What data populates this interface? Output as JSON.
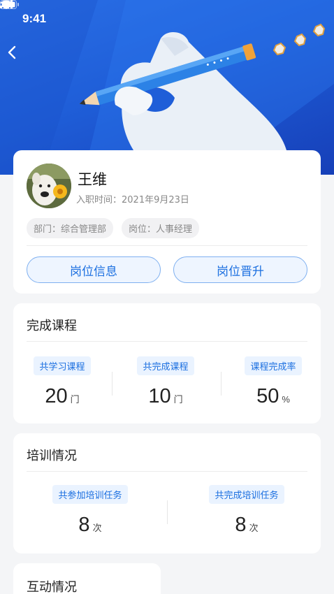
{
  "status_bar": {
    "time": "9:41"
  },
  "profile": {
    "name": "王维",
    "join_date": "入职时间：2021年9月23日",
    "department": "部门：综合管理部",
    "position": "岗位：人事经理",
    "btn_info": "岗位信息",
    "btn_promotion": "岗位晋升"
  },
  "courses": {
    "title": "完成课程",
    "stats": [
      {
        "label": "共学习课程",
        "value": "20",
        "unit": "门"
      },
      {
        "label": "共完成课程",
        "value": "10",
        "unit": "门"
      },
      {
        "label": "课程完成率",
        "value": "50",
        "unit": "%"
      }
    ]
  },
  "training": {
    "title": "培训情况",
    "stats": [
      {
        "label": "共参加培训任务",
        "value": "8",
        "unit": "次"
      },
      {
        "label": "共完成培训任务",
        "value": "8",
        "unit": "次"
      }
    ]
  },
  "interaction": {
    "title": "互动情况"
  }
}
